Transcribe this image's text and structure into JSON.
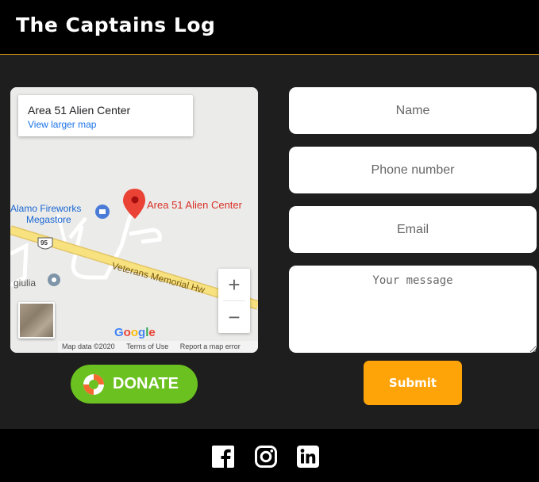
{
  "header": {
    "title": "The Captains Log"
  },
  "map": {
    "place_name": "Area 51 Alien Center",
    "view_larger": "View larger map",
    "pin_label": "Area 51 Alien Center",
    "store_line1": "Alamo Fireworks",
    "store_line2": "Megastore",
    "poi_label": "e giulia",
    "road_label": "Veterans Memorial Hw",
    "route_shield": "95",
    "zoom_in": "+",
    "zoom_out": "−",
    "google_logo": "Google",
    "attribution": {
      "map_data": "Map data ©2020",
      "terms": "Terms of Use",
      "report": "Report a map error"
    },
    "pin_color": "#ea4335",
    "road_color": "#f7e27f"
  },
  "donate": {
    "label": "DONATE",
    "color": "#6bc11f"
  },
  "form": {
    "name_placeholder": "Name",
    "phone_placeholder": "Phone number",
    "email_placeholder": "Email",
    "message_placeholder": "Your message",
    "submit_label": "Submit",
    "submit_color": "#ffa408"
  },
  "footer": {
    "social": [
      {
        "icon": "facebook-icon"
      },
      {
        "icon": "instagram-icon"
      },
      {
        "icon": "linkedin-icon"
      }
    ]
  },
  "colors": {
    "accent": "#e09a17",
    "background": "#1e1e1e",
    "header": "#000000"
  }
}
